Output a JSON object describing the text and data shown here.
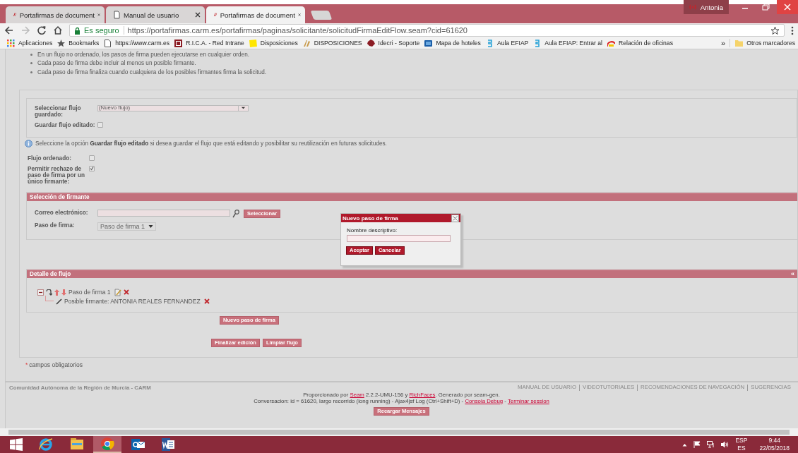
{
  "browser": {
    "tabs": [
      {
        "title": "Portafirmas de document",
        "selected": false,
        "kind": "logo"
      },
      {
        "title": "Manual de usuario",
        "selected": false,
        "kind": "page"
      },
      {
        "title": "Portafirmas de document",
        "selected": true,
        "kind": "logo"
      }
    ],
    "profile": "Antonia",
    "secure_label": "Es seguro",
    "url": "https://portafirmas.carm.es/portafirmas/paginas/solicitante/solicitudFirmaEditFlow.seam?cid=61620",
    "bookmarks": [
      {
        "label": "Aplicaciones",
        "kind": "apps"
      },
      {
        "label": "Bookmarks",
        "kind": "star"
      },
      {
        "label": "https://www.carm.es",
        "kind": "page"
      },
      {
        "label": "R.I.C.A. - Red Intrane",
        "kind": "rica"
      },
      {
        "label": "Disposiciones",
        "kind": "note"
      },
      {
        "label": "DISPOSICIONES",
        "kind": "wheat"
      },
      {
        "label": "Idecri - Soporte",
        "kind": "map"
      },
      {
        "label": "Mapa de hoteles",
        "kind": "book"
      },
      {
        "label": "Aula EFIAP",
        "kind": "efiap"
      },
      {
        "label": "Aula EFIAP: Entrar al",
        "kind": "efiap"
      },
      {
        "label": "Relación de oficinas",
        "kind": "arc"
      }
    ],
    "more": "»",
    "other_bookmarks": "Otros marcadores"
  },
  "notes": [
    "En un flujo no ordenado, los pasos de firma pueden ejecutarse en cualquier orden.",
    "Cada paso de firma debe incluir al menos un posible firmante.",
    "Cada paso de firma finaliza cuando cualquiera de los posibles firmantes firma la solicitud."
  ],
  "flow_form": {
    "saved_flow": {
      "label": "Seleccionar flujo guardado:",
      "value": "(Nuevo flujo)"
    },
    "save_edited": {
      "label": "Guardar flujo editado:",
      "checked": false
    },
    "info": "Seleccione la opción **Guardar flujo editado** si desea guardar el flujo que está editando y posibilitar su reutilización en futuras solicitudes.",
    "ordered": {
      "label": "Flujo ordenado:",
      "checked": false
    },
    "allow_reject": {
      "label": "Permitir rechazo de paso de firma por un único firmante:",
      "checked": true
    }
  },
  "signer_section": {
    "title": "Selección de firmante",
    "email_label": "Correo electrónico:",
    "select_button": "Seleccionar",
    "step_label": "Paso de firma:",
    "step_value": "Paso de firma 1"
  },
  "flow_detail": {
    "title": "Detalle de flujo",
    "collapse": "«",
    "tree": [
      {
        "label": "Paso de firma 1",
        "expanded": true,
        "children": [
          {
            "label": "Posible firmante: ANTONIA REALES FERNANDEZ"
          }
        ]
      }
    ]
  },
  "new_step_button": "Nuevo paso de firma",
  "action_buttons": [
    "Finalizar edición",
    "Limpiar flujo"
  ],
  "required_note": {
    "mark": "*",
    "text": "campos obligatorios"
  },
  "footer": {
    "org": "Comunidad Autónoma de la Región de Murcia - CARM",
    "links": [
      "MANUAL DE USUARIO",
      "VIDEOTUTORIALES",
      "RECOMENDACIONES DE NAVEGACIÓN",
      "SUGERENCIAS"
    ],
    "lines": [
      [
        {
          "text": "Proporcionado por "
        },
        {
          "text": "Seam",
          "link": true
        },
        {
          "text": " 2.2.2-UMU-156 y "
        },
        {
          "text": "RichFaces",
          "link": true
        },
        {
          "text": ". Generado por seam-gen."
        }
      ],
      [
        {
          "text": "Conversacion: id = 61620, largo recorrido (long running) - Ajax4jsf Log (Ctrl+Shift+D) - "
        },
        {
          "text": "Consola Debug",
          "link": true
        },
        {
          "text": " - "
        },
        {
          "text": "Terminar session",
          "link": true
        }
      ]
    ],
    "reload_button": "Recargar Mensajes"
  },
  "dialog": {
    "title": "Nuevo paso de firma",
    "field_label": "Nombre descriptivo:",
    "buttons": [
      "Aceptar",
      "Cancelar"
    ]
  },
  "taskbar": {
    "apps": [
      {
        "kind": "ie",
        "selected": false
      },
      {
        "kind": "explorer",
        "selected": false
      },
      {
        "kind": "chrome",
        "selected": true
      },
      {
        "kind": "outlook",
        "selected": false
      },
      {
        "kind": "word",
        "selected": false
      }
    ],
    "language": "ESP",
    "layout": "ES",
    "time": "9:44",
    "date": "22/05/2018"
  }
}
